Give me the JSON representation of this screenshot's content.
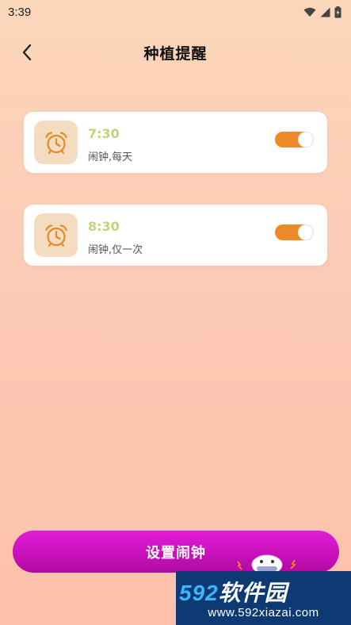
{
  "status_bar": {
    "time": "3:39",
    "icons": [
      "wifi-icon",
      "cellular-signal-icon",
      "battery-charging-icon"
    ]
  },
  "header": {
    "title": "种植提醒",
    "back_icon": "chevron-left-icon"
  },
  "alarms": [
    {
      "time": "7:30",
      "description": "闹钟,每天",
      "enabled": true,
      "icon": "alarm-clock-icon"
    },
    {
      "time": "8:30",
      "description": "闹钟,仅一次",
      "enabled": true,
      "icon": "alarm-clock-icon"
    }
  ],
  "footer": {
    "set_alarm_label": "设置闹钟"
  },
  "watermark": {
    "brand_number": "592",
    "brand_text": "软件园",
    "url": "www.592xiazai.com"
  },
  "colors": {
    "accent_orange": "#ec8a2a",
    "alarm_time": "#c9d07a",
    "icon_bg": "#f3dcc0",
    "button_magenta": "#c812bd",
    "watermark_bg": "#0d3a73"
  }
}
